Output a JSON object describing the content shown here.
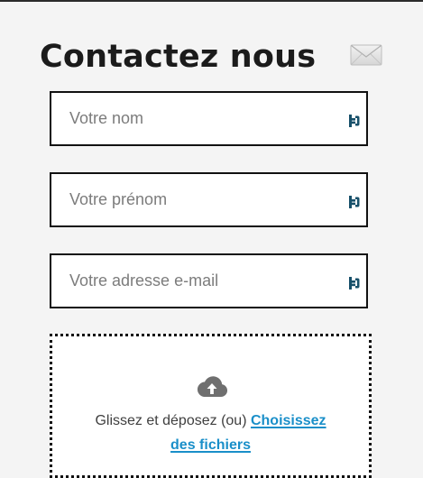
{
  "form": {
    "title": "Contactez nous",
    "title_icon": "envelope-icon",
    "fields": [
      {
        "name": "nom",
        "placeholder": "Votre nom",
        "value": "",
        "icon": "autofill-key-icon"
      },
      {
        "name": "prenom",
        "placeholder": "Votre prénom",
        "value": "",
        "icon": "autofill-key-icon"
      },
      {
        "name": "email",
        "placeholder": "Votre adresse e-mail",
        "value": "",
        "icon": "autofill-key-icon"
      }
    ],
    "upload": {
      "icon": "cloud-upload-icon",
      "prompt": "Glissez et déposez (ou)",
      "link_part1": "Choisissez",
      "link_part2": "des fichiers"
    }
  },
  "colors": {
    "background": "#f4f4f4",
    "title": "#1b1b1b",
    "field_border": "#111111",
    "placeholder": "#7c7c7c",
    "field_icon": "#17506a",
    "link": "#1a8fc9",
    "cloud_icon": "#6f6f6f"
  }
}
